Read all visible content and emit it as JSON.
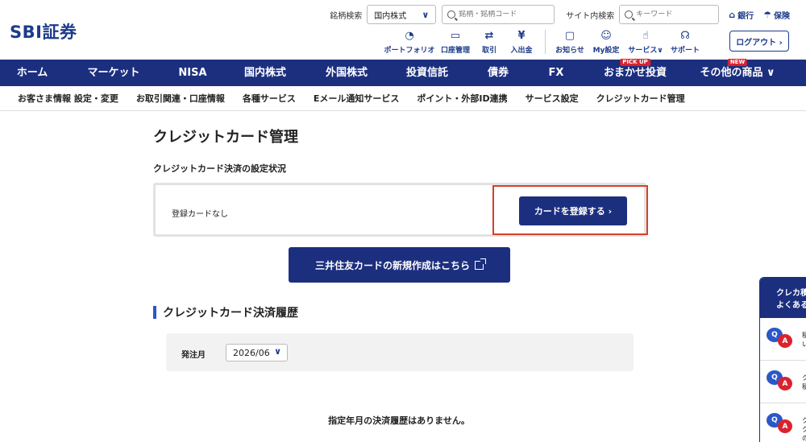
{
  "header": {
    "logo": "SBI証券",
    "symbol_search_label": "銘柄検索",
    "market_select": "国内株式",
    "symbol_search_placeholder": "銘柄・銘柄コード",
    "site_search_label": "サイト内検索",
    "site_search_placeholder": "キーワード",
    "bank_link": "銀行",
    "insurance_link": "保険",
    "icons": [
      {
        "label": "ポートフォリオ",
        "icon": "pie-chart-icon"
      },
      {
        "label": "口座管理",
        "icon": "wallet-icon"
      },
      {
        "label": "取引",
        "icon": "exchange-icon"
      },
      {
        "label": "入出金",
        "icon": "yen-icon"
      },
      {
        "label": "お知らせ",
        "icon": "message-icon"
      },
      {
        "label": "My設定",
        "icon": "user-icon"
      },
      {
        "label": "サービス∨",
        "icon": "hand-icon"
      },
      {
        "label": "サポート",
        "icon": "headset-icon"
      }
    ],
    "logout": "ログアウト ›"
  },
  "main_nav": [
    {
      "label": "ホーム"
    },
    {
      "label": "マーケット"
    },
    {
      "label": "NISA"
    },
    {
      "label": "国内株式"
    },
    {
      "label": "外国株式"
    },
    {
      "label": "投資信託"
    },
    {
      "label": "債券"
    },
    {
      "label": "FX"
    },
    {
      "label": "おまかせ投資",
      "badge": "PICK UP"
    },
    {
      "label": "その他の商品 ∨",
      "badge": "NEW"
    }
  ],
  "sub_nav": [
    "お客さま情報 設定・変更",
    "お取引関連・口座情報",
    "各種サービス",
    "Eメール通知サービス",
    "ポイント・外部ID連携",
    "サービス設定",
    "クレジットカード管理"
  ],
  "page": {
    "title": "クレジットカード管理",
    "status_section": "クレジットカード決済の設定状況",
    "no_card": "登録カードなし",
    "register_button": "カードを登録する ›",
    "mitsui_button": "三井住友カードの新規作成はこちら",
    "history_title": "クレジットカード決済履歴",
    "order_month_label": "発注月",
    "order_month_value": "2026/06",
    "no_history": "指定年月の決済履歴はありません。"
  },
  "faq": {
    "head_line1": "クレカ積",
    "head_line2": "よくある",
    "items": [
      {
        "line1": "積",
        "line2": "い"
      },
      {
        "line1": "ク",
        "line2": "積"
      },
      {
        "line1": "ク",
        "line2": "ク",
        "line3": "の"
      }
    ]
  },
  "colors": {
    "brand_navy": "#1c2f7f",
    "highlight_red": "#d6402a",
    "accent_blue": "#2a58c7"
  }
}
